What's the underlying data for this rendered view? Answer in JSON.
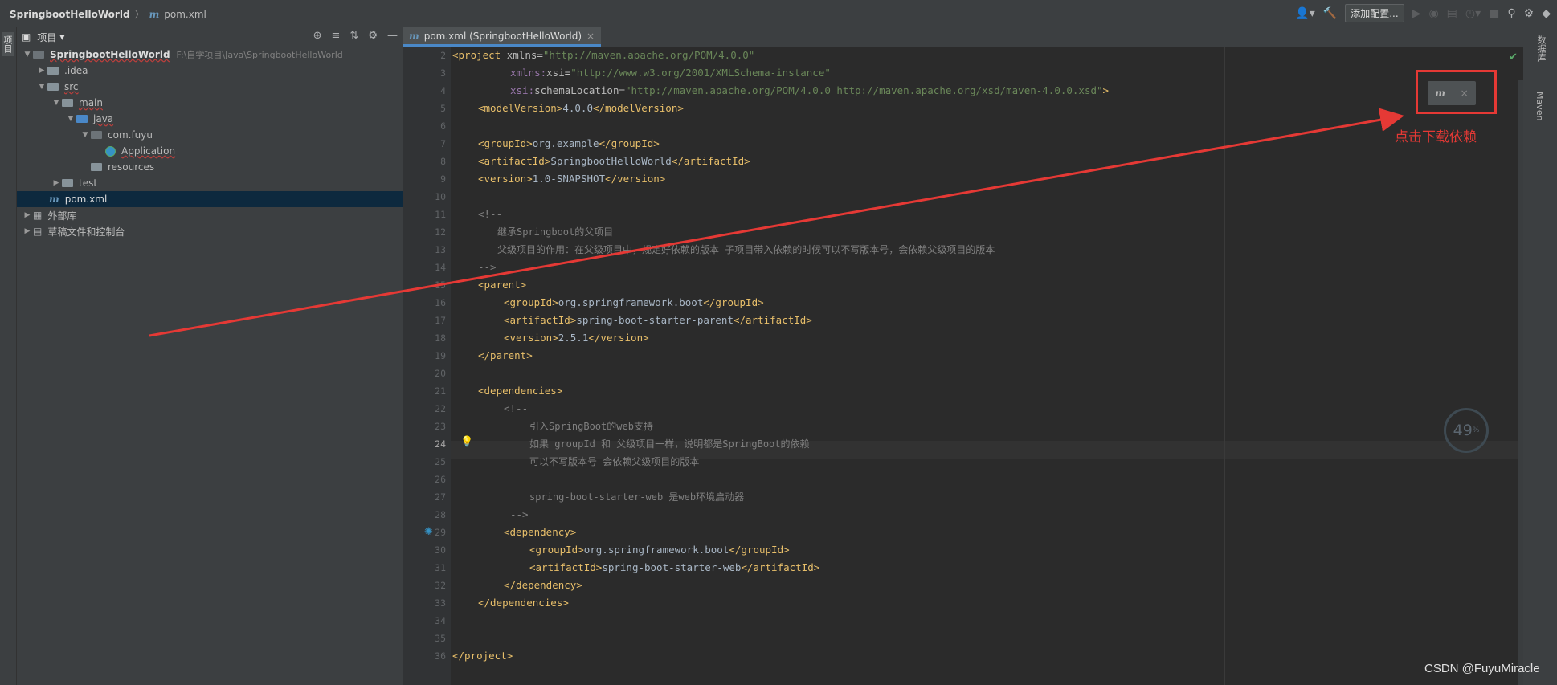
{
  "topbar": {
    "project_name": "SpringbootHelloWorld",
    "breadcrumb_sep": "〉",
    "file_icon": "m",
    "file_name": "pom.xml",
    "add_config_label": "添加配置..."
  },
  "left_strip": {
    "label": "项目"
  },
  "project_panel": {
    "title": "项目",
    "tree": {
      "root_name": "SpringbootHelloWorld",
      "root_path": "F:\\自学项目\\Java\\SpringbootHelloWorld",
      "idea": ".idea",
      "src": "src",
      "main": "main",
      "java": "java",
      "package": "com.fuyu",
      "application": "Application",
      "resources": "resources",
      "test": "test",
      "pom": "pom.xml",
      "external_libs": "外部库",
      "scratches": "草稿文件和控制台"
    }
  },
  "editor": {
    "tab_icon": "m",
    "tab_label": "pom.xml (SpringbootHelloWorld)",
    "tab_close": "×",
    "line_numbers": [
      "2",
      "3",
      "4",
      "5",
      "6",
      "7",
      "8",
      "9",
      "10",
      "11",
      "12",
      "13",
      "14",
      "15",
      "16",
      "17",
      "18",
      "19",
      "20",
      "21",
      "22",
      "23",
      "24",
      "25",
      "26",
      "27",
      "28",
      "29",
      "30",
      "31",
      "32",
      "33",
      "34",
      "35",
      "36"
    ],
    "code": {
      "l2_tag": "<project",
      "l2_attr": " xmlns=",
      "l2_val": "\"http://maven.apache.org/POM/4.0.0\"",
      "l3_ns": "xmlns:",
      "l3_attr": "xsi=",
      "l3_val": "\"http://www.w3.org/2001/XMLSchema-instance\"",
      "l4_ns": "xsi:",
      "l4_attr": "schemaLocation=",
      "l4_val": "\"http://maven.apache.org/POM/4.0.0 http://maven.apache.org/xsd/maven-4.0.0.xsd\"",
      "l4_end": ">",
      "l5_open": "<modelVersion>",
      "l5_text": "4.0.0",
      "l5_close": "</modelVersion>",
      "l7_open": "<groupId>",
      "l7_text": "org.example",
      "l7_close": "</groupId>",
      "l8_open": "<artifactId>",
      "l8_text": "SpringbootHelloWorld",
      "l8_close": "</artifactId>",
      "l9_open": "<version>",
      "l9_text": "1.0-SNAPSHOT",
      "l9_close": "</version>",
      "l11": "<!--",
      "l12": "继承Springboot的父项目",
      "l13": "父级项目的作用：在父级项目中，规定好依赖的版本 子项目带入依赖的时候可以不写版本号，会依赖父级项目的版本",
      "l14": "-->",
      "l15": "<parent>",
      "l16_open": "<groupId>",
      "l16_text": "org.springframework.boot",
      "l16_close": "</groupId>",
      "l17_open": "<artifactId>",
      "l17_text": "spring-boot-starter-parent",
      "l17_close": "</artifactId>",
      "l18_open": "<version>",
      "l18_text": "2.5.1",
      "l18_close": "</version>",
      "l19": "</parent>",
      "l21": "<dependencies>",
      "l22": "<!--",
      "l23": "引入SpringBoot的web支持",
      "l24": "如果 groupId 和 父级项目一样，说明都是SpringBoot的依赖",
      "l25": "可以不写版本号 会依赖父级项目的版本",
      "l27": "spring-boot-starter-web 是web环境启动器",
      "l28": "-->",
      "l29": "<dependency>",
      "l30_open": "<groupId>",
      "l30_text": "org.springframework.boot",
      "l30_close": "</groupId>",
      "l31_open": "<artifactId>",
      "l31_text": "spring-boot-starter-web",
      "l31_close": "</artifactId>",
      "l32": "</dependency>",
      "l33": "</dependencies>",
      "l36": "</project>"
    }
  },
  "right_strip": {
    "db_label": "数据库",
    "maven_label": "Maven"
  },
  "maven_reload": {
    "icon": "m",
    "close": "×"
  },
  "annotation": {
    "text": "点击下载依赖",
    "color": "#e53935"
  },
  "progress": {
    "value": "49",
    "unit": "%"
  },
  "watermark": "CSDN @FuyuMiracle"
}
